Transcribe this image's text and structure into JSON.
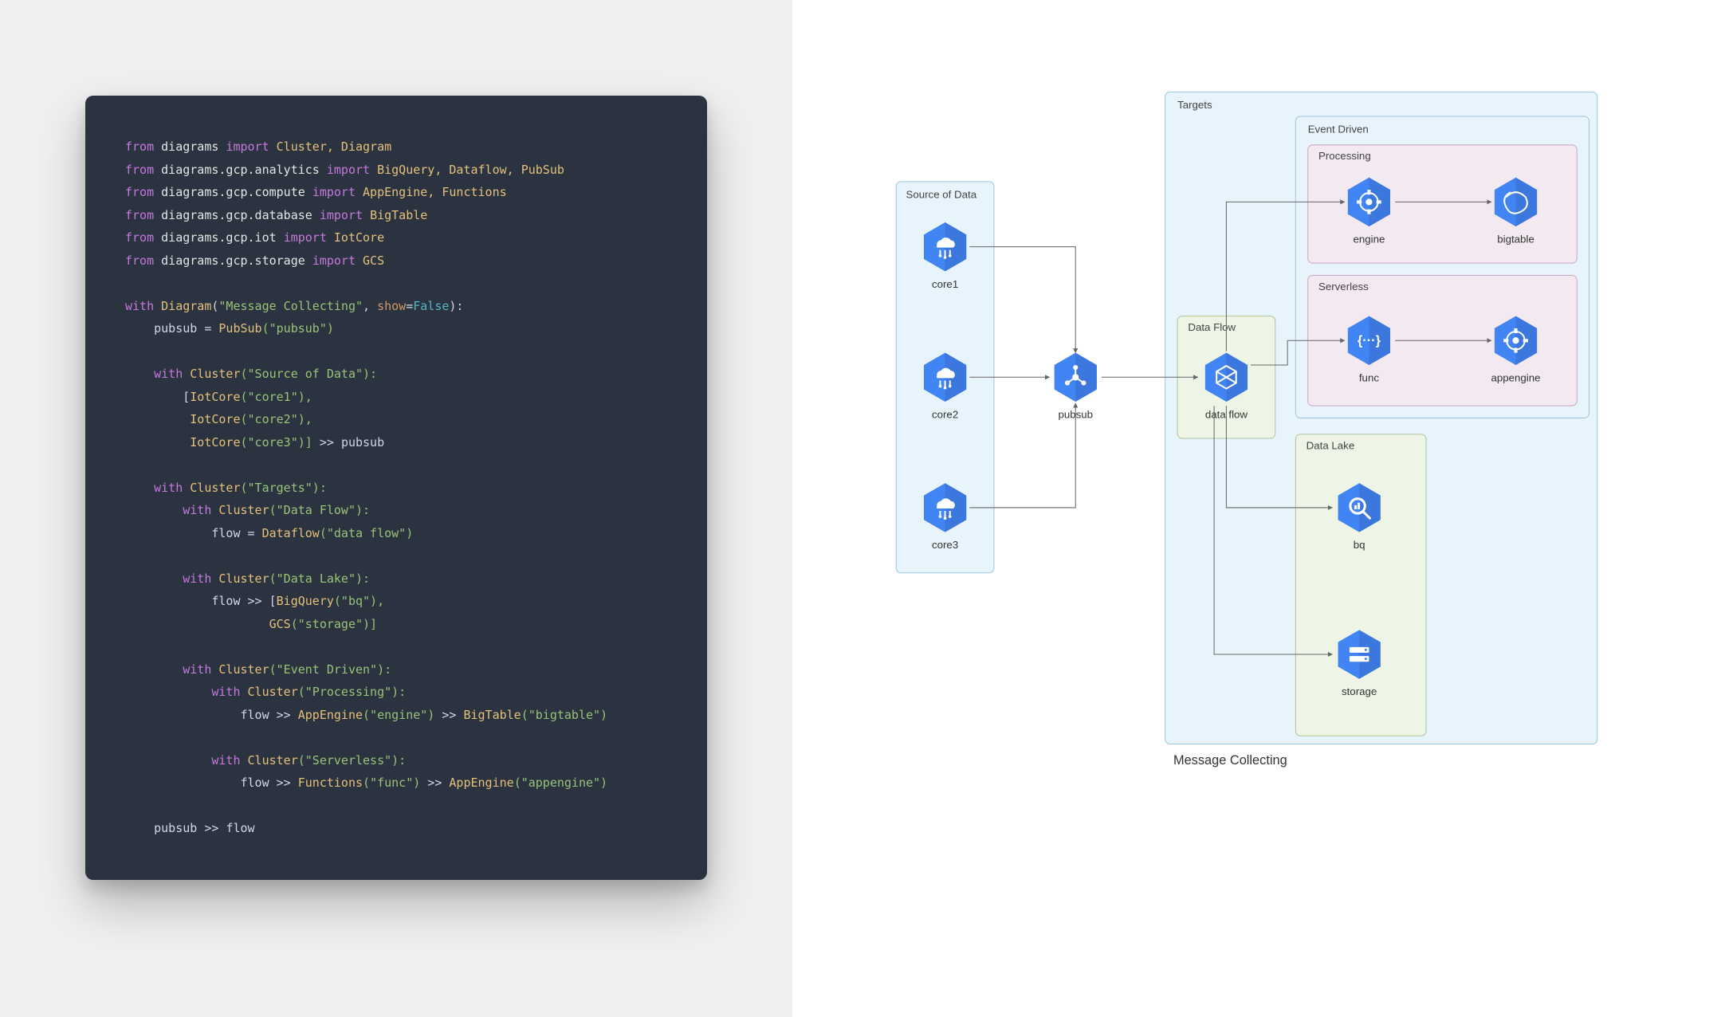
{
  "diagram": {
    "title": "Message Collecting",
    "clusters": {
      "source": {
        "label": "Source of Data"
      },
      "targets": {
        "label": "Targets"
      },
      "dataflow": {
        "label": "Data Flow"
      },
      "datalake": {
        "label": "Data Lake"
      },
      "eventdriven": {
        "label": "Event Driven"
      },
      "processing": {
        "label": "Processing"
      },
      "serverless": {
        "label": "Serverless"
      }
    },
    "nodes": {
      "core1": {
        "label": "core1",
        "type": "IotCore"
      },
      "core2": {
        "label": "core2",
        "type": "IotCore"
      },
      "core3": {
        "label": "core3",
        "type": "IotCore"
      },
      "pubsub": {
        "label": "pubsub",
        "type": "PubSub"
      },
      "dataflow": {
        "label": "data flow",
        "type": "Dataflow"
      },
      "engine": {
        "label": "engine",
        "type": "AppEngine"
      },
      "bigtable": {
        "label": "bigtable",
        "type": "BigTable"
      },
      "func": {
        "label": "func",
        "type": "Functions"
      },
      "appengine": {
        "label": "appengine",
        "type": "AppEngine"
      },
      "bq": {
        "label": "bq",
        "type": "BigQuery"
      },
      "storage": {
        "label": "storage",
        "type": "GCS"
      }
    },
    "edges": [
      [
        "core1",
        "pubsub"
      ],
      [
        "core2",
        "pubsub"
      ],
      [
        "core3",
        "pubsub"
      ],
      [
        "pubsub",
        "dataflow"
      ],
      [
        "dataflow",
        "engine"
      ],
      [
        "engine",
        "bigtable"
      ],
      [
        "dataflow",
        "func"
      ],
      [
        "func",
        "appengine"
      ],
      [
        "dataflow",
        "bq"
      ],
      [
        "dataflow",
        "storage"
      ]
    ]
  },
  "code": {
    "l1": {
      "kw1": "from",
      "mod": "diagrams",
      "kw2": "import",
      "names": "Cluster, Diagram"
    },
    "l2": {
      "kw1": "from",
      "mod": "diagrams.gcp.analytics",
      "kw2": "import",
      "names": "BigQuery, Dataflow, PubSub"
    },
    "l3": {
      "kw1": "from",
      "mod": "diagrams.gcp.compute",
      "kw2": "import",
      "names": "AppEngine, Functions"
    },
    "l4": {
      "kw1": "from",
      "mod": "diagrams.gcp.database",
      "kw2": "import",
      "names": "BigTable"
    },
    "l5": {
      "kw1": "from",
      "mod": "diagrams.gcp.iot",
      "kw2": "import",
      "names": "IotCore"
    },
    "l6": {
      "kw1": "from",
      "mod": "diagrams.gcp.storage",
      "kw2": "import",
      "names": "GCS"
    },
    "l8": {
      "kw": "with",
      "cls": "Diagram",
      "p": "(",
      "str": "\"Message Collecting\"",
      "c": ", ",
      "arg": "show",
      "eq": "=",
      "val": "False",
      "rp": "):"
    },
    "l9": {
      "indent": "    ",
      "name": "pubsub",
      "eq": " = ",
      "cls": "PubSub",
      "arg": "(\"pubsub\")"
    },
    "l11": {
      "indent": "    ",
      "kw": "with",
      "cls": "Cluster",
      "arg": "(\"Source of Data\"):"
    },
    "l12": {
      "indent": "        ",
      "open": "[",
      "cls": "IotCore",
      "arg": "(\"core1\"),"
    },
    "l13": {
      "indent": "         ",
      "cls": "IotCore",
      "arg": "(\"core2\"),"
    },
    "l14": {
      "indent": "         ",
      "cls": "IotCore",
      "arg": "(\"core3\")]",
      "op": " >> ",
      "var": "pubsub"
    },
    "l16": {
      "indent": "    ",
      "kw": "with",
      "cls": "Cluster",
      "arg": "(\"Targets\"):"
    },
    "l17": {
      "indent": "        ",
      "kw": "with",
      "cls": "Cluster",
      "arg": "(\"Data Flow\"):"
    },
    "l18": {
      "indent": "            ",
      "name": "flow",
      "eq": " = ",
      "cls": "Dataflow",
      "arg": "(\"data flow\")"
    },
    "l20": {
      "indent": "        ",
      "kw": "with",
      "cls": "Cluster",
      "arg": "(\"Data Lake\"):"
    },
    "l21": {
      "indent": "            ",
      "var": "flow",
      "op": " >> ",
      "open": "[",
      "cls": "BigQuery",
      "arg": "(\"bq\"),"
    },
    "l22": {
      "indent": "                    ",
      "cls": "GCS",
      "arg": "(\"storage\")]"
    },
    "l24": {
      "indent": "        ",
      "kw": "with",
      "cls": "Cluster",
      "arg": "(\"Event Driven\"):"
    },
    "l25": {
      "indent": "            ",
      "kw": "with",
      "cls": "Cluster",
      "arg": "(\"Processing\"):"
    },
    "l26": {
      "indent": "                ",
      "var": "flow",
      "op": " >> ",
      "cls": "AppEngine",
      "arg": "(\"engine\")",
      "op2": " >> ",
      "cls2": "BigTable",
      "arg2": "(\"bigtable\")"
    },
    "l28": {
      "indent": "            ",
      "kw": "with",
      "cls": "Cluster",
      "arg": "(\"Serverless\"):"
    },
    "l29": {
      "indent": "                ",
      "var": "flow",
      "op": " >> ",
      "cls": "Functions",
      "arg": "(\"func\")",
      "op2": " >> ",
      "cls2": "AppEngine",
      "arg2": "(\"appengine\")"
    },
    "l31": {
      "indent": "    ",
      "var": "pubsub",
      "op": " >> ",
      "var2": "flow"
    }
  }
}
